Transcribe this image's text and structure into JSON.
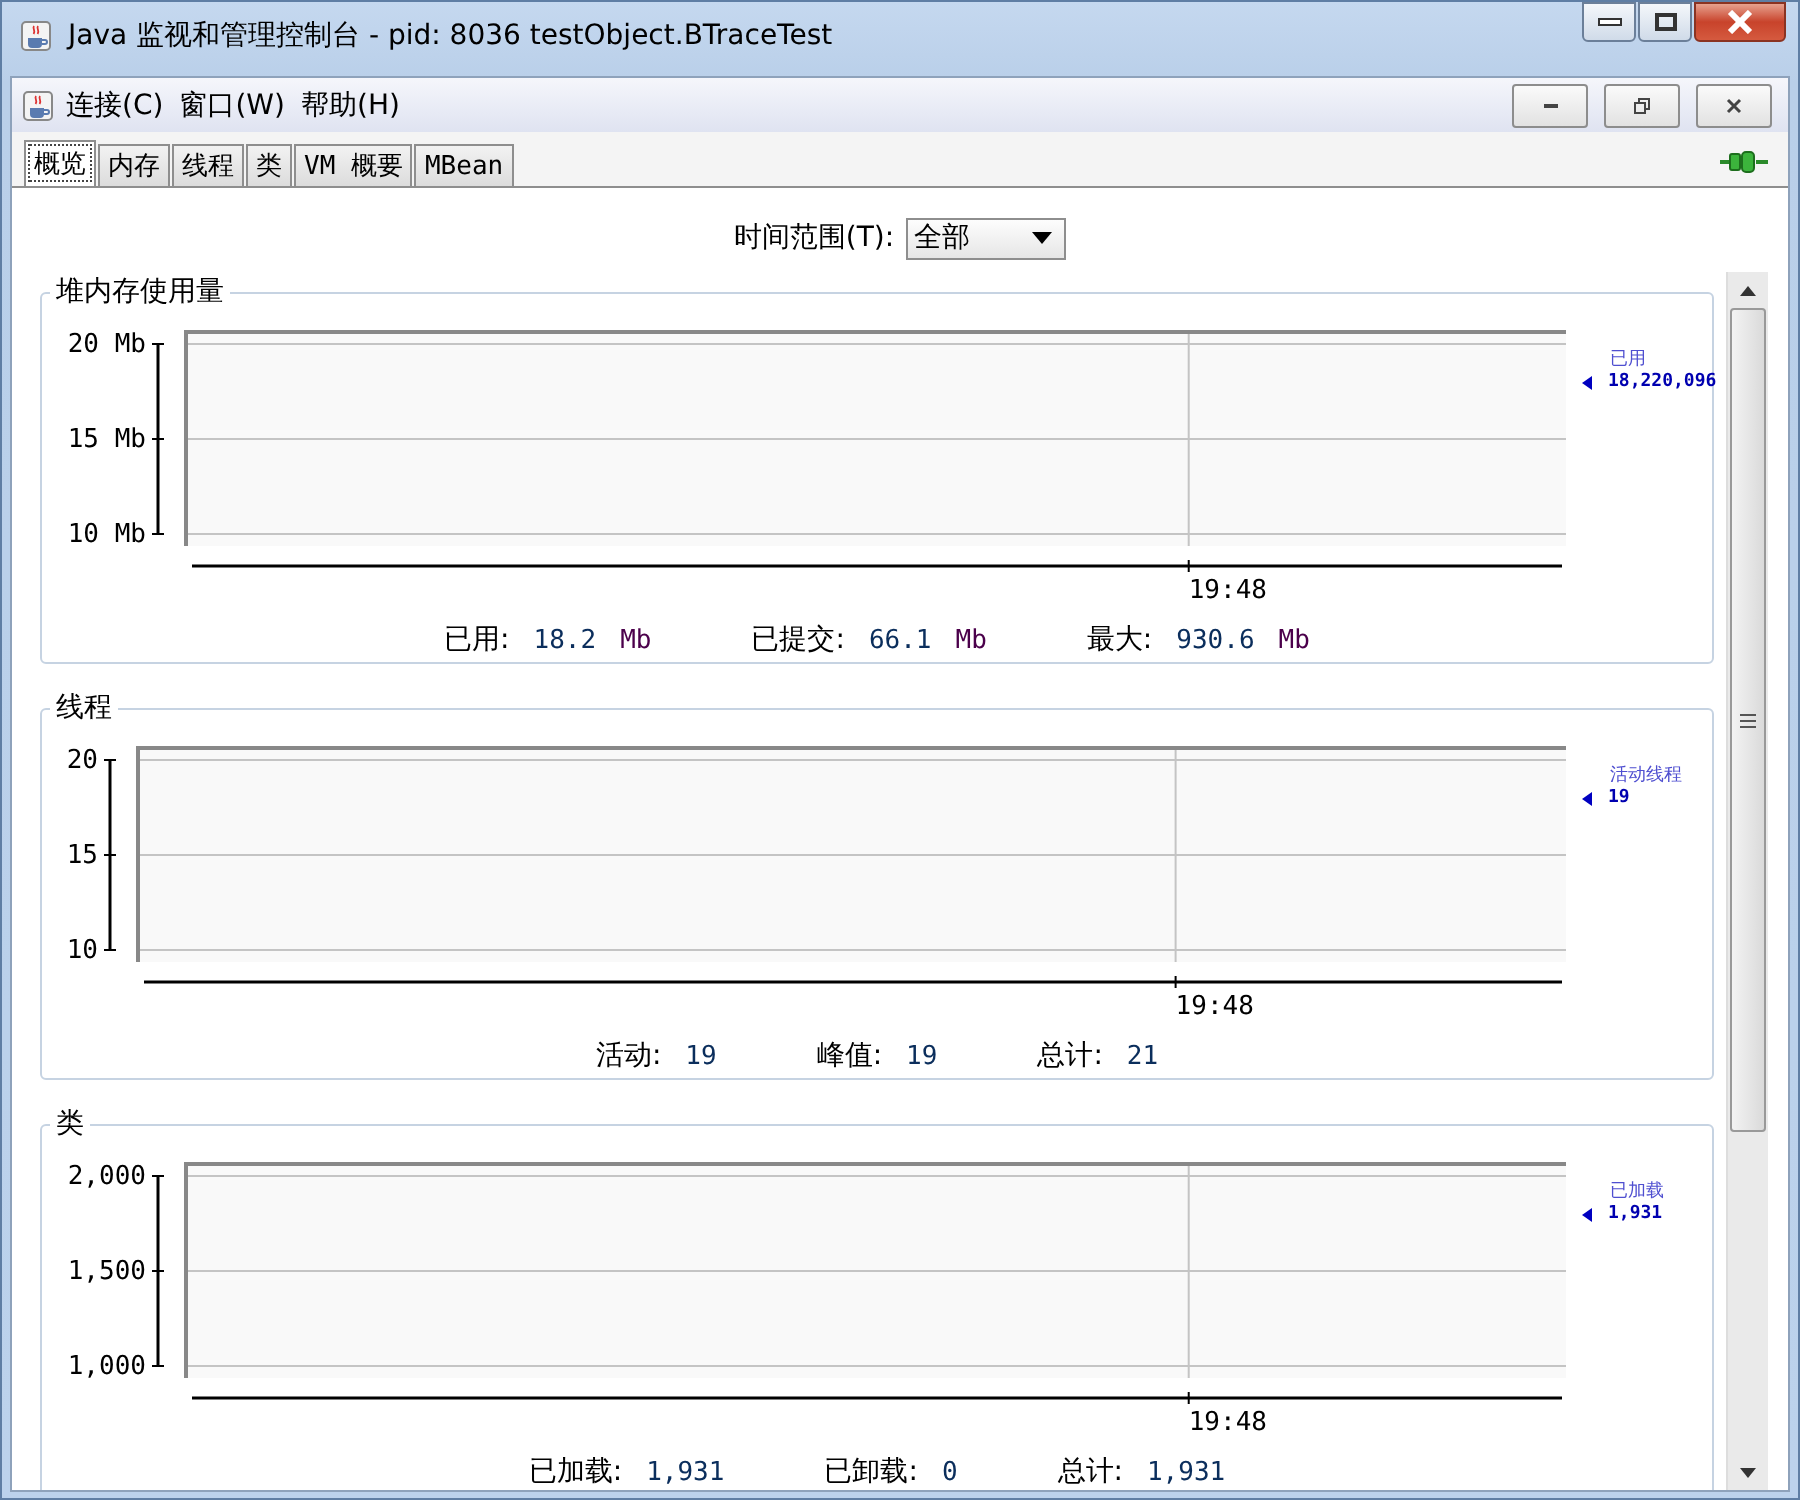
{
  "window": {
    "title": "Java 监视和管理控制台 - pid: 8036 testObject.BTraceTest"
  },
  "menu": [
    "连接(C)",
    "窗口(W)",
    "帮助(H)"
  ],
  "tabs": [
    {
      "label": "概览",
      "selected": true
    },
    {
      "label": "内存",
      "selected": false
    },
    {
      "label": "线程",
      "selected": false
    },
    {
      "label": "类",
      "selected": false
    },
    {
      "label": "VM 概要",
      "selected": false
    },
    {
      "label": "MBean",
      "selected": false
    }
  ],
  "time_range": {
    "label": "时间范围(T):",
    "value": "全部"
  },
  "panels": [
    {
      "title": "堆内存使用量",
      "y_axis_labels": [
        "20 Mb",
        "15 Mb",
        "10 Mb"
      ],
      "time_label": "19:48",
      "legend": {
        "name": "已用",
        "value": "18,220,096"
      },
      "stats": [
        {
          "label": "已用:",
          "value": "18.2",
          "unit": "Mb"
        },
        {
          "label": "已提交:",
          "value": "66.1",
          "unit": "Mb"
        },
        {
          "label": "最大:",
          "value": "930.6",
          "unit": "Mb"
        }
      ]
    },
    {
      "title": "线程",
      "y_axis_labels": [
        "20",
        "15",
        "10"
      ],
      "time_label": "19:48",
      "legend": {
        "name": "活动线程",
        "value": "19"
      },
      "stats": [
        {
          "label": "活动:",
          "value": "19"
        },
        {
          "label": "峰值:",
          "value": "19"
        },
        {
          "label": "总计:",
          "value": "21"
        }
      ]
    },
    {
      "title": "类",
      "y_axis_labels": [
        "2,000",
        "1,500",
        "1,000"
      ],
      "time_label": "19:48",
      "legend": {
        "name": "已加载",
        "value": "1,931"
      },
      "stats": [
        {
          "label": "已加载:",
          "value": "1,931"
        },
        {
          "label": "已卸载:",
          "value": "0"
        },
        {
          "label": "总计:",
          "value": "1,931"
        }
      ]
    }
  ]
}
